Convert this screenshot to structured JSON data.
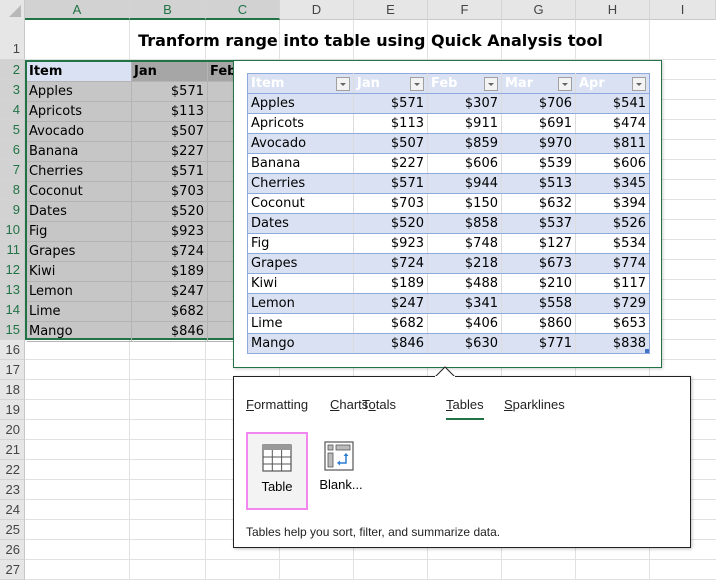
{
  "sheet": {
    "columns": [
      "A",
      "B",
      "C",
      "D",
      "E",
      "F",
      "G",
      "H",
      "I"
    ],
    "rows": [
      "1",
      "2",
      "3",
      "4",
      "5",
      "6",
      "7",
      "8",
      "9",
      "10",
      "11",
      "12",
      "13",
      "14",
      "15",
      "16",
      "17",
      "18",
      "19",
      "20",
      "21",
      "22",
      "23",
      "24",
      "25",
      "26",
      "27"
    ],
    "title": "Tranform range into table using Quick Analysis tool"
  },
  "range": {
    "headers": [
      "Item",
      "Jan",
      "Feb"
    ],
    "rows": [
      {
        "item": "Apples",
        "jan": "$571"
      },
      {
        "item": "Apricots",
        "jan": "$113"
      },
      {
        "item": "Avocado",
        "jan": "$507"
      },
      {
        "item": "Banana",
        "jan": "$227"
      },
      {
        "item": "Cherries",
        "jan": "$571"
      },
      {
        "item": "Coconut",
        "jan": "$703"
      },
      {
        "item": "Dates",
        "jan": "$520"
      },
      {
        "item": "Fig",
        "jan": "$923"
      },
      {
        "item": "Grapes",
        "jan": "$724"
      },
      {
        "item": "Kiwi",
        "jan": "$189"
      },
      {
        "item": "Lemon",
        "jan": "$247"
      },
      {
        "item": "Lime",
        "jan": "$682"
      },
      {
        "item": "Mango",
        "jan": "$846"
      }
    ]
  },
  "preview": {
    "headers": [
      "Item",
      "Jan",
      "Feb",
      "Mar",
      "Apr"
    ],
    "rows": [
      [
        "Apples",
        "$571",
        "$307",
        "$706",
        "$541"
      ],
      [
        "Apricots",
        "$113",
        "$911",
        "$691",
        "$474"
      ],
      [
        "Avocado",
        "$507",
        "$859",
        "$970",
        "$811"
      ],
      [
        "Banana",
        "$227",
        "$606",
        "$539",
        "$606"
      ],
      [
        "Cherries",
        "$571",
        "$944",
        "$513",
        "$345"
      ],
      [
        "Coconut",
        "$703",
        "$150",
        "$632",
        "$394"
      ],
      [
        "Dates",
        "$520",
        "$858",
        "$537",
        "$526"
      ],
      [
        "Fig",
        "$923",
        "$748",
        "$127",
        "$534"
      ],
      [
        "Grapes",
        "$724",
        "$218",
        "$673",
        "$774"
      ],
      [
        "Kiwi",
        "$189",
        "$488",
        "$210",
        "$117"
      ],
      [
        "Lemon",
        "$247",
        "$341",
        "$558",
        "$729"
      ],
      [
        "Lime",
        "$682",
        "$406",
        "$860",
        "$653"
      ],
      [
        "Mango",
        "$846",
        "$630",
        "$771",
        "$838"
      ]
    ]
  },
  "quick_analysis": {
    "tabs": [
      {
        "label": "Formatting",
        "accel": "F",
        "rest": "ormatting",
        "active": false
      },
      {
        "label": "Charts",
        "accel": "C",
        "rest": "harts",
        "active": false
      },
      {
        "label": "Totals",
        "pre": "T",
        "accel": "o",
        "rest": "tals",
        "active": false
      },
      {
        "label": "Tables",
        "accel": "T",
        "rest": "ables",
        "active": true
      },
      {
        "label": "Sparklines",
        "accel": "S",
        "rest": "parklines",
        "active": false
      }
    ],
    "tiles": [
      {
        "label": "Table",
        "icon": "table-icon",
        "selected": true
      },
      {
        "label": "Blank...",
        "icon": "blank-pivot-icon",
        "selected": false
      }
    ],
    "description": "Tables help you sort, filter, and summarize data."
  },
  "colors": {
    "accent_green": "#217346",
    "table_band": "#d9e1f2",
    "table_border": "#8ea9db",
    "selection_fill": "#c6c6c6",
    "tile_highlight": "#f287f0"
  }
}
